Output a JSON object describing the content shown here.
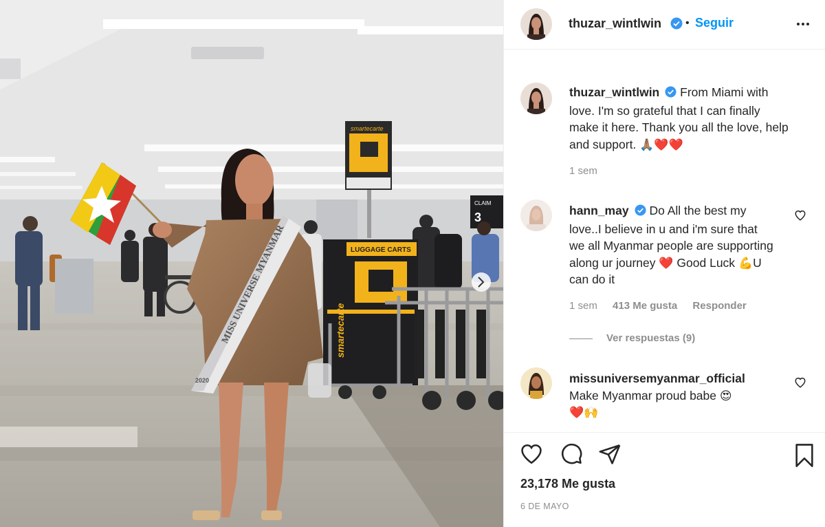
{
  "post": {
    "photo_alt": "",
    "author": {
      "username": "thuzar_wintlwin",
      "verified": true,
      "follow_label": "Seguir"
    },
    "caption": {
      "username": "thuzar_wintlwin",
      "text": "From Miami with love. I'm so grateful that I can finally make it here. Thank you all the love, help and support.",
      "emojis": "🙏🏽❤️❤️",
      "time": "1 sem"
    },
    "photo_signs": {
      "smartecarte_top": "smartecarte",
      "luggage_carts": "LUGGAGE CARTS",
      "smartecarte_side": "smartecarte",
      "sash": "MISS UNIVERSE MYANMAR",
      "sash_year": "2020",
      "gate_sign": "CLAIM",
      "gate_number": "3"
    },
    "comments": [
      {
        "username": "hann_may",
        "verified": true,
        "text": "Do All the best my love..I believe in u and i'm sure that we all Myanmar people are supporting along ur journey",
        "emoji_1": "❤️",
        "text_2": "Good Luck",
        "emoji_2": "💪",
        "text_3": "U can do it",
        "time": "1 sem",
        "likes": "413 Me gusta",
        "reply_label": "Responder",
        "view_replies": "Ver respuestas (9)"
      },
      {
        "username": "missuniversemyanmar_official",
        "verified": false,
        "text": "Make Myanmar proud babe",
        "emoji_1": "😍",
        "emojis_2": "❤️🙌"
      }
    ],
    "likes_count": "23,178 Me gusta",
    "date": "6 DE MAYO"
  },
  "colors": {
    "link_blue": "#0095f6",
    "verified_blue": "#3897f0",
    "text_dark": "#262626",
    "text_gray": "#8e8e8e"
  }
}
